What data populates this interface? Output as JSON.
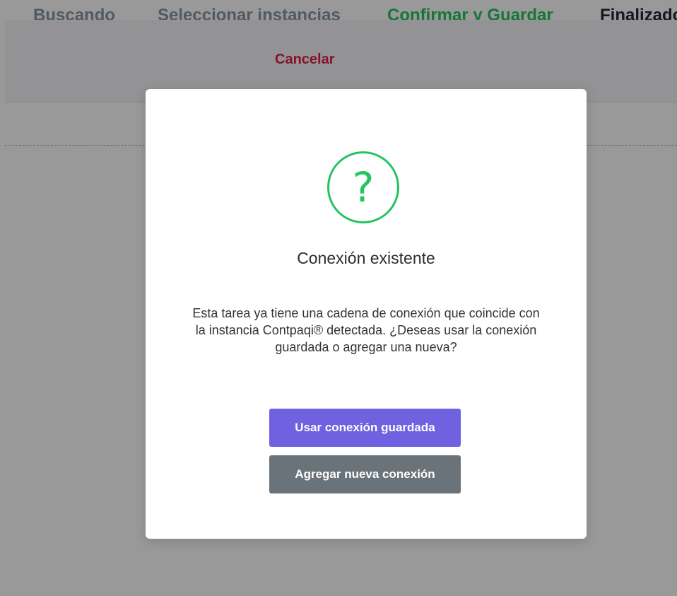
{
  "steps": [
    {
      "label": "Buscando"
    },
    {
      "label": "Seleccionar instancias"
    },
    {
      "label": "Confirmar y Guardar"
    },
    {
      "label": "Finalizado"
    }
  ],
  "action_bar": {
    "cancel_label": "Cancelar"
  },
  "modal": {
    "icon": "question-icon",
    "icon_glyph": "?",
    "title": "Conexión existente",
    "message": "Esta tarea ya tiene una cadena de conexión que coincide con la instancia Contpaqi® detectada. ¿Deseas usar la conexión guardada o agregar una nueva?",
    "primary_button": "Usar conexión guardada",
    "secondary_button": "Agregar nueva conexión"
  },
  "colors": {
    "accent_green": "#22c55e",
    "primary_button": "#6f61df",
    "secondary_button": "#6b737a",
    "cancel": "#e11d48"
  }
}
